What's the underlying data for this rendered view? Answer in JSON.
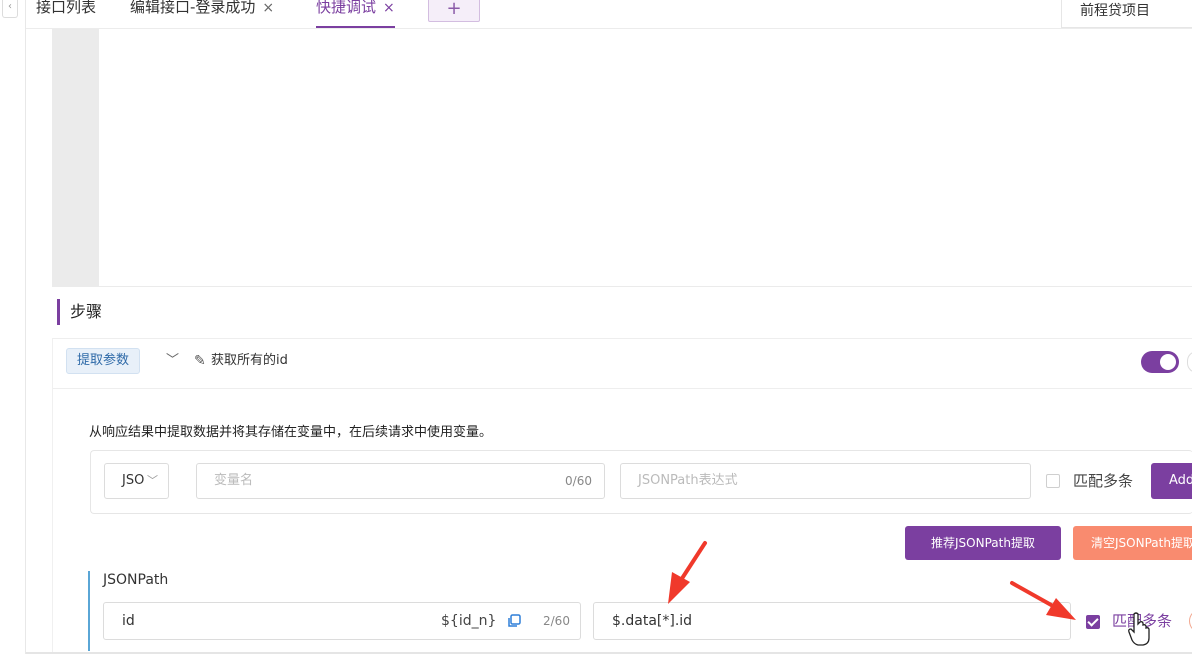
{
  "tabs": [
    {
      "label": "接口列表",
      "closable": false,
      "active": false
    },
    {
      "label": "编辑接口-登录成功",
      "closable": true,
      "active": false
    },
    {
      "label": "快捷调试",
      "closable": true,
      "active": true
    }
  ],
  "tab_close_glyph": "×",
  "tab_add_glyph": "+",
  "project_select": {
    "value": "前程贷项目"
  },
  "steps": {
    "title": "步骤",
    "step": {
      "type_tag": "提取参数",
      "name": "获取所有的id",
      "enabled": true,
      "description": "从响应结果中提取数据并将其存储在变量中，在后续请求中使用变量。",
      "add_row": {
        "type_select": "JSO",
        "var_placeholder": "变量名",
        "var_count": "0/60",
        "expr_placeholder": "JSONPath表达式",
        "match_multiple_label": "匹配多条",
        "match_multiple_checked": false,
        "add_button": "Add"
      },
      "recommend_button": "推荐JSONPath提取",
      "clear_button": "清空JSONPath提取",
      "jsonpath_section": {
        "title": "JSONPath",
        "name_value": "id",
        "variable_ref": "${id_n}",
        "count": "2/60",
        "expression": "$.data[*].id",
        "match_multiple_label": "匹配多条",
        "match_multiple_checked": true
      }
    }
  },
  "colors": {
    "accent": "#7b3fa0",
    "danger": "#f98b6f",
    "arrow": "#f0392b",
    "tag_bg": "#e8f0f9"
  }
}
